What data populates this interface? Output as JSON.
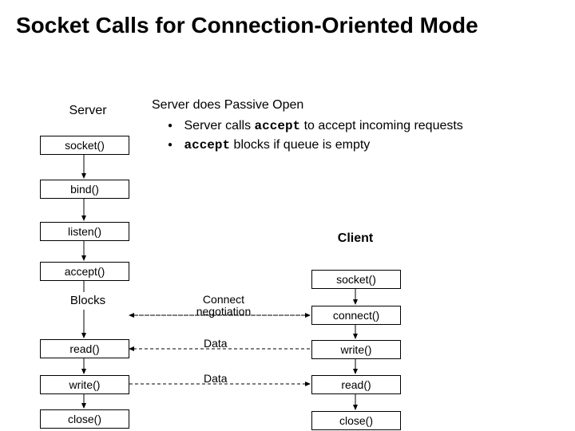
{
  "title": "Socket Calls for Connection-Oriented Mode",
  "info": {
    "heading": "Server does Passive Open",
    "bullet1_pre": "Server calls ",
    "bullet1_code": "accept",
    "bullet1_post": " to accept incoming requests",
    "bullet2_code": "accept",
    "bullet2_post": " blocks if queue is empty"
  },
  "server": {
    "label": "Server",
    "socket": "socket()",
    "bind": "bind()",
    "listen": "listen()",
    "accept": "accept()",
    "blocks": "Blocks",
    "read": "read()",
    "write": "write()",
    "close": "close()"
  },
  "client": {
    "label": "Client",
    "socket": "socket()",
    "connect": "connect()",
    "write": "write()",
    "read": "read()",
    "close": "close()"
  },
  "flows": {
    "negotiation": "Connect negotiation",
    "data1": "Data",
    "data2": "Data"
  }
}
